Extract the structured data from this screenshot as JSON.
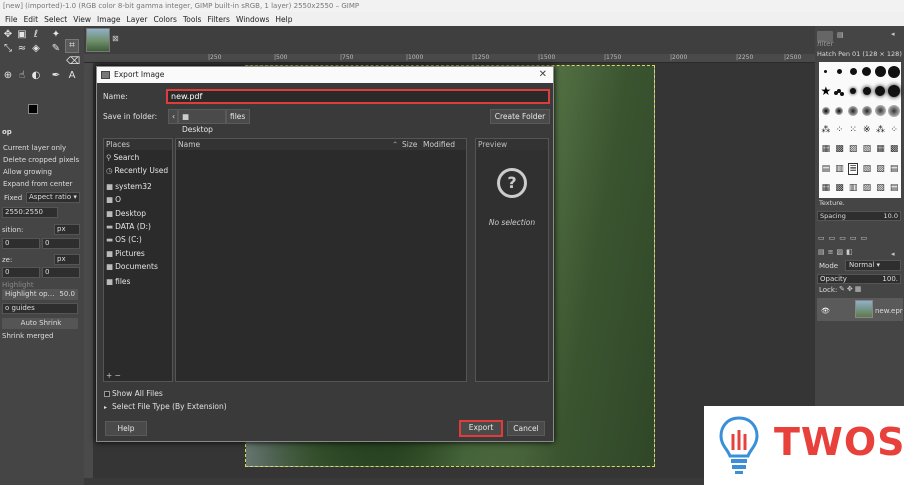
{
  "window": {
    "title": "[new] (imported)-1.0 (RGB color 8-bit gamma integer, GIMP built-in sRGB, 1 layer) 2550x2550 – GIMP"
  },
  "menu": [
    "File",
    "Edit",
    "Select",
    "View",
    "Image",
    "Layer",
    "Colors",
    "Tools",
    "Filters",
    "Windows",
    "Help"
  ],
  "ruler_ticks": [
    "|250",
    "|500",
    "|750",
    "|1000",
    "|1250",
    "|1500",
    "|1750",
    "|2000",
    "|2250",
    "|2500"
  ],
  "tool_options": {
    "title": "op",
    "current_layer_only": "Current layer only",
    "delete_cropped": "Delete cropped pixels",
    "allow_growing": "Allow growing",
    "expand_from_center": "Expand from center",
    "fixed": "Fixed",
    "aspect_ratio": "Aspect ratio",
    "ratio_value": "2550:2550",
    "position_label": "sition:",
    "px1": "px",
    "zero1": "0",
    "zero2": "0",
    "size_label": "ze:",
    "px2": "px",
    "zero3": "0",
    "zero4": "0",
    "highlight": "Highlight",
    "highlight_op": "Highlight op…",
    "highlight_value": "50.0",
    "guides": "o guides",
    "auto_shrink": "Auto Shrink",
    "shrink_merged": "Shrink merged"
  },
  "right_panel": {
    "filter": "filter",
    "brush_name": "Hatch Pen 01 (128 × 128)",
    "texture": "Texture.",
    "spacing": "Spacing",
    "spacing_value": "10.0",
    "mode_label": "Mode",
    "mode_value": "Normal",
    "opacity_label": "Opacity",
    "opacity_value": "100.",
    "lock_label": "Lock:",
    "layer_name": "new.epr"
  },
  "dialog": {
    "title": "Export Image",
    "name_label": "Name:",
    "name_value": "new.pdf",
    "save_in_label": "Save in folder:",
    "crumb_desktop": "Desktop",
    "crumb_files": "files",
    "create_folder": "Create Folder",
    "places_header": "Places",
    "places": [
      {
        "icon": "search-icon",
        "glyph": "⚲",
        "label": "Search"
      },
      {
        "icon": "recent-icon",
        "glyph": "◷",
        "label": "Recently Used"
      },
      {
        "icon": "folder-icon",
        "glyph": "■",
        "label": "system32"
      },
      {
        "icon": "folder-icon",
        "glyph": "■",
        "label": "O"
      },
      {
        "icon": "folder-icon",
        "glyph": "■",
        "label": "Desktop"
      },
      {
        "icon": "drive-icon",
        "glyph": "▬",
        "label": "DATA (D:)"
      },
      {
        "icon": "drive-icon",
        "glyph": "▬",
        "label": "OS (C:)"
      },
      {
        "icon": "folder-icon",
        "glyph": "■",
        "label": "Pictures"
      },
      {
        "icon": "folder-icon",
        "glyph": "■",
        "label": "Documents"
      },
      {
        "icon": "folder-icon",
        "glyph": "■",
        "label": "files"
      }
    ],
    "add_remove": "+ −",
    "col_name": "Name",
    "col_size": "Size",
    "col_modified": "Modified",
    "preview_header": "Preview",
    "no_selection": "No selection",
    "show_all_files": "Show All Files",
    "select_file_type": "Select File Type (By Extension)",
    "help": "Help",
    "export": "Export",
    "cancel": "Cancel"
  },
  "watermark": {
    "text": "TWOS"
  },
  "colors": {
    "highlight_red": "#e03c3c",
    "twos_red": "#e8403a"
  }
}
